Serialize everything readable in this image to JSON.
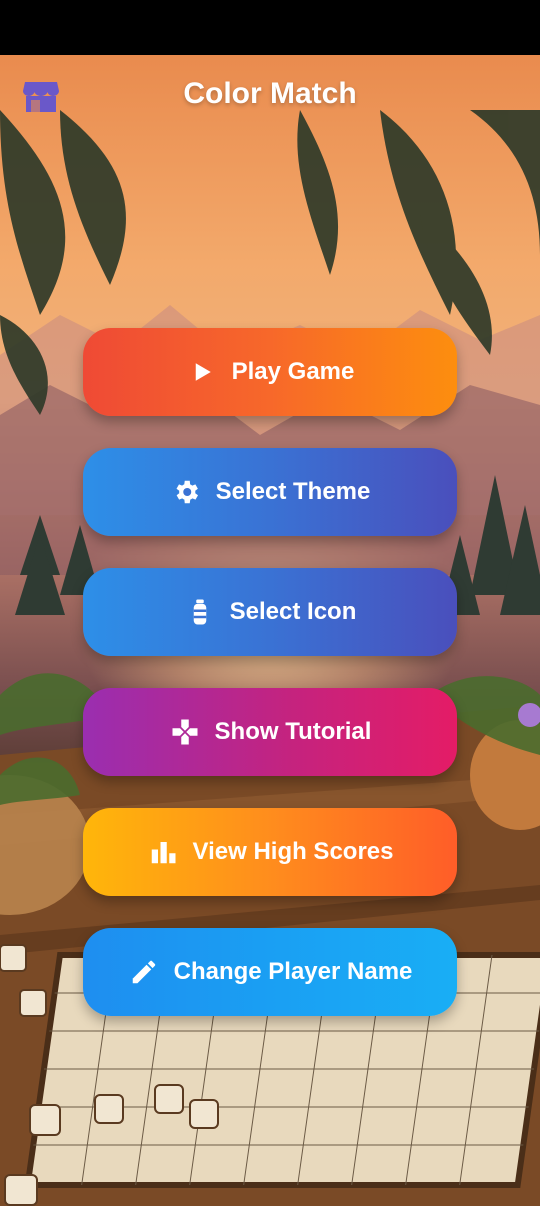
{
  "app": {
    "title": "Color Match",
    "store_icon": "store-icon"
  },
  "menu": {
    "items": [
      {
        "label": "Play Game",
        "icon": "play-icon"
      },
      {
        "label": "Select Theme",
        "icon": "gear-icon"
      },
      {
        "label": "Select Icon",
        "icon": "bottle-icon"
      },
      {
        "label": "Show Tutorial",
        "icon": "gamepad-icon"
      },
      {
        "label": "View High Scores",
        "icon": "bar-chart-icon"
      },
      {
        "label": "Change Player Name",
        "icon": "pencil-icon"
      }
    ]
  },
  "colors": {
    "play": "#f7682a",
    "theme": "#3a72d4",
    "icon": "#3a72d4",
    "tutorial": "#c4237f",
    "scores": "#ff8d1d",
    "name": "#1a9ff3",
    "store_icon": "#6a58c9"
  }
}
